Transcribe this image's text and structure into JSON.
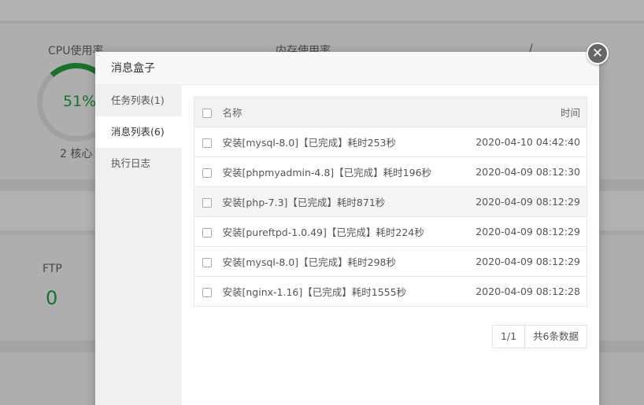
{
  "background": {
    "cpu_label": "CPU使用率",
    "cpu_value": "51%",
    "cpu_fraction": 0.51,
    "cores": "2 核心",
    "mem_label": "内存使用率",
    "slash": "/",
    "ftp_label": "FTP",
    "ftp_value": "0"
  },
  "modal": {
    "title": "消息盒子",
    "close_icon": "close-icon",
    "sidebar": [
      {
        "label": "任务列表(1)"
      },
      {
        "label": "消息列表(6)"
      },
      {
        "label": "执行日志"
      }
    ],
    "table": {
      "headers": {
        "name": "名称",
        "time": "时间"
      },
      "rows": [
        {
          "name": "安装[mysql-8.0]【已完成】耗时253秒",
          "time": "2020-04-10 04:42:40"
        },
        {
          "name": "安装[phpmyadmin-4.8]【已完成】耗时196秒",
          "time": "2020-04-09 08:12:30"
        },
        {
          "name": "安装[php-7.3]【已完成】耗时871秒",
          "time": "2020-04-09 08:12:29"
        },
        {
          "name": "安装[pureftpd-1.0.49]【已完成】耗时224秒",
          "time": "2020-04-09 08:12:29"
        },
        {
          "name": "安装[mysql-8.0]【已完成】耗时298秒",
          "time": "2020-04-09 08:12:29"
        },
        {
          "name": "安装[nginx-1.16]【已完成】耗时1555秒",
          "time": "2020-04-09 08:12:28"
        }
      ]
    },
    "pagination": {
      "page": "1/1",
      "total": "共6条数据"
    }
  },
  "colors": {
    "accent": "#20a53a",
    "overlay": "rgba(0,0,0,0.3)"
  }
}
